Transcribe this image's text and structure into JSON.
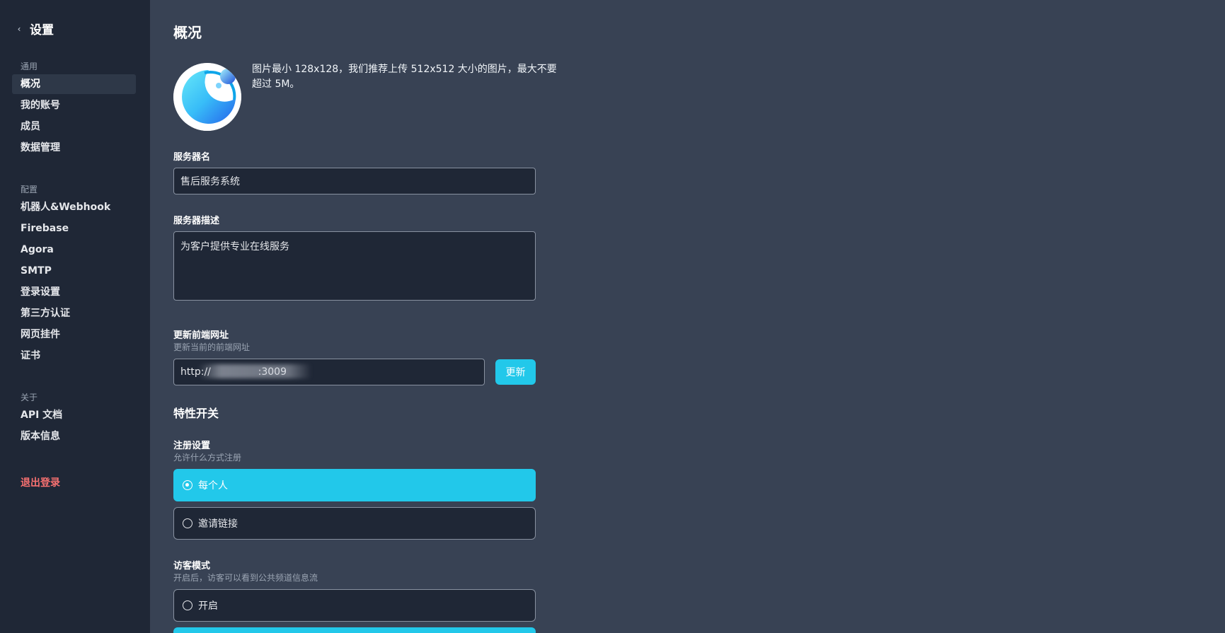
{
  "sidebar": {
    "back_icon": "chevron-left-icon",
    "title": "设置",
    "groups": [
      {
        "label": "通用",
        "items": [
          "概况",
          "我的账号",
          "成员",
          "数据管理"
        ]
      },
      {
        "label": "配置",
        "items": [
          "机器人&Webhook",
          "Firebase",
          "Agora",
          "SMTP",
          "登录设置",
          "第三方认证",
          "网页挂件",
          "证书"
        ]
      },
      {
        "label": "关于",
        "items": [
          "API 文档",
          "版本信息"
        ]
      }
    ],
    "logout": "退出登录"
  },
  "main": {
    "title": "概况",
    "avatar_hint": "图片最小 128x128，我们推荐上传 512x512 大小的图片，最大不要超过 5M。",
    "server_name": {
      "label": "服务器名",
      "value": "售后服务系统"
    },
    "server_desc": {
      "label": "服务器描述",
      "value": "为客户提供专业在线服务"
    },
    "frontend_url": {
      "label": "更新前端网址",
      "sub": "更新当前的前端网址",
      "value": "http://               :3009",
      "button": "更新"
    },
    "features_title": "特性开关",
    "registration": {
      "label": "注册设置",
      "sub": "允许什么方式注册",
      "options": [
        "每个人",
        "邀请链接"
      ],
      "selected": 0
    },
    "guest_mode": {
      "label": "访客模式",
      "sub": "开启后，访客可以看到公共频道信息流",
      "options": [
        "开启",
        ""
      ],
      "selected": 1
    }
  },
  "colors": {
    "accent": "#22c8ea",
    "sidebar_bg": "#1f2736",
    "main_bg": "#384254",
    "danger": "#f87171"
  }
}
